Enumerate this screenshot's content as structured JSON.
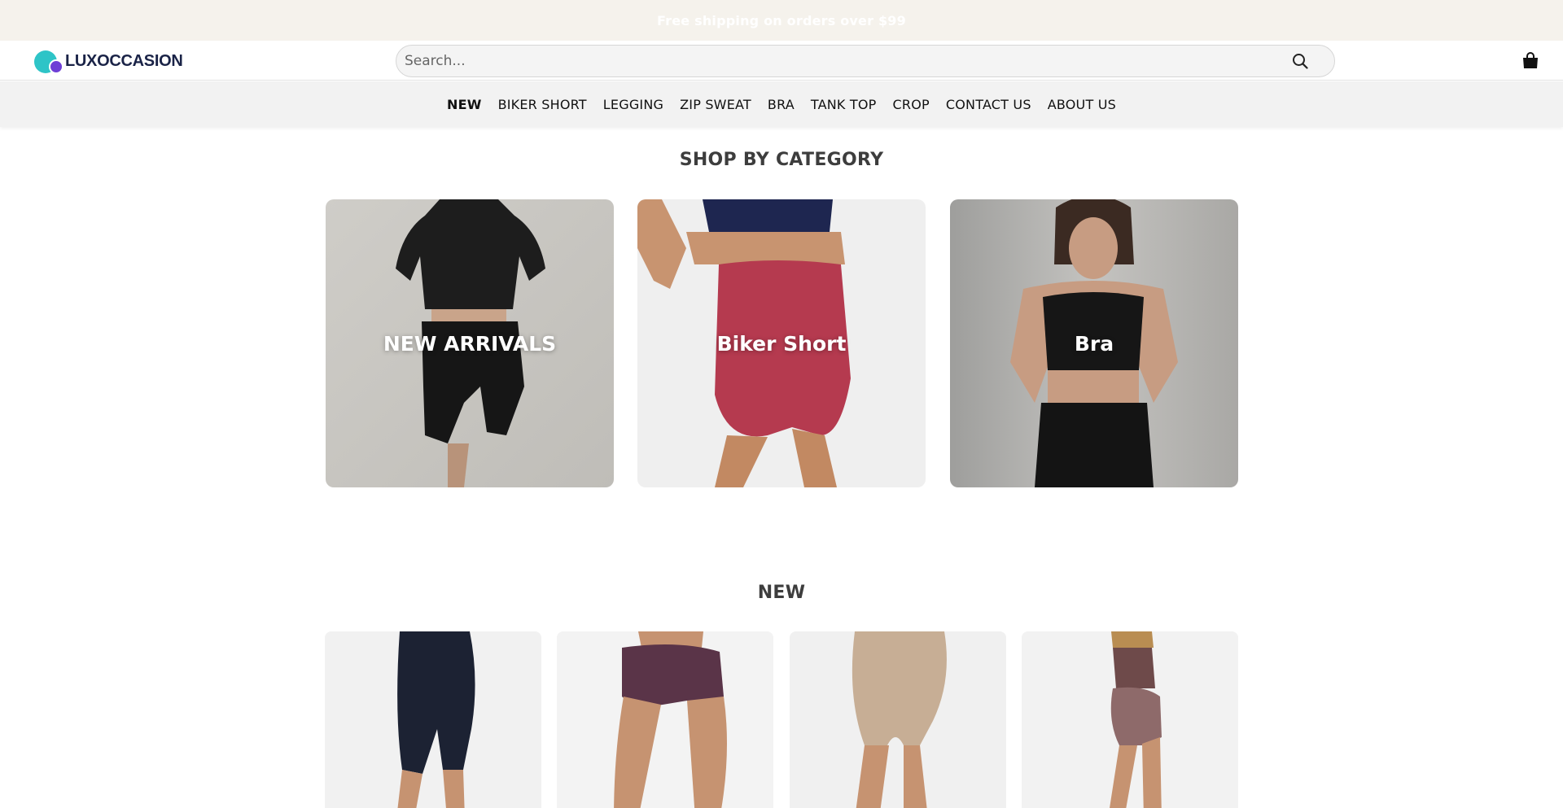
{
  "announcement": {
    "text": "Free shipping on orders over $99"
  },
  "header": {
    "logo_text": "LUXOCCASION",
    "search_placeholder": "Search...",
    "search_icon": "search-icon",
    "cart_icon": "shopping-bag-icon"
  },
  "nav": {
    "items": [
      {
        "label": "NEW",
        "active": true
      },
      {
        "label": "BIKER SHORT",
        "active": false
      },
      {
        "label": "LEGGING",
        "active": false
      },
      {
        "label": "ZIP SWEAT",
        "active": false
      },
      {
        "label": "BRA",
        "active": false
      },
      {
        "label": "TANK TOP",
        "active": false
      },
      {
        "label": "CROP",
        "active": false
      },
      {
        "label": "CONTACT US",
        "active": false
      },
      {
        "label": "ABOUT US",
        "active": false
      }
    ]
  },
  "categories": {
    "title": "SHOP BY CATEGORY",
    "items": [
      {
        "label": "NEW ARRIVALS"
      },
      {
        "label": "Biker Short"
      },
      {
        "label": "Bra"
      }
    ]
  },
  "new_section": {
    "title": "NEW",
    "products": [
      {
        "color": "#1c2233"
      },
      {
        "color": "#5a3448"
      },
      {
        "color": "#c7ae95"
      },
      {
        "color": "#8e6a6a"
      }
    ]
  },
  "colors": {
    "announce_bg": "#f5f2ec",
    "logo_teal": "#2ec4c7",
    "logo_purple": "#6e3fd6",
    "nav_bg": "#f2f2f2"
  }
}
